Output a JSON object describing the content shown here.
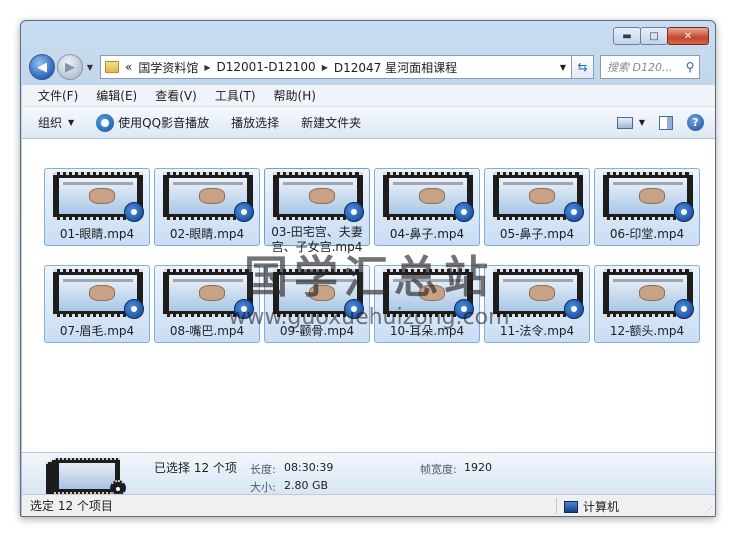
{
  "window": {
    "caption_buttons": {
      "minimize": "▬",
      "maximize": "□",
      "close": "✕"
    }
  },
  "nav": {
    "back_glyph": "◀",
    "forward_glyph": "▶",
    "history_glyph": "▼",
    "breadcrumb_prefix": "«",
    "breadcrumbs": [
      "国学资料馆",
      "D12001-D12100",
      "D12047 星河面相课程"
    ],
    "separator_glyph": "▶",
    "address_dropdown_glyph": "▼",
    "refresh_glyph": "⇆",
    "search_placeholder": "搜索 D120...",
    "search_icon": "search-icon",
    "search_glyph": "⚲"
  },
  "menu": {
    "items": [
      "文件(F)",
      "编辑(E)",
      "查看(V)",
      "工具(T)",
      "帮助(H)"
    ]
  },
  "toolbar": {
    "organize": "组织",
    "caret": "▼",
    "play_qq": "使用QQ影音播放",
    "play_selection": "播放选择",
    "new_folder": "新建文件夹",
    "view_caret": "▼",
    "help_glyph": "?"
  },
  "files": [
    {
      "name": "01-眼睛.mp4"
    },
    {
      "name": "02-眼睛.mp4"
    },
    {
      "name": "03-田宅宫、夫妻宫、子女宫.mp4"
    },
    {
      "name": "04-鼻子.mp4"
    },
    {
      "name": "05-鼻子.mp4"
    },
    {
      "name": "06-印堂.mp4"
    },
    {
      "name": "07-眉毛.mp4"
    },
    {
      "name": "08-嘴巴.mp4"
    },
    {
      "name": "09-颧骨.mp4"
    },
    {
      "name": "10-耳朵.mp4"
    },
    {
      "name": "11-法令.mp4"
    },
    {
      "name": "12-额头.mp4"
    }
  ],
  "watermark": {
    "cn": "国学汇总站",
    "url": "www.guoxuehuizong.com"
  },
  "details": {
    "selected": "已选择 12 个项",
    "length_label": "长度:",
    "length_value": "08:30:39",
    "size_label": "大小:",
    "size_value": "2.80 GB",
    "frame_width_label": "帧宽度:",
    "frame_width_value": "1920"
  },
  "status": {
    "left": "选定 12 个项目",
    "right": "计算机",
    "grip": "⋰"
  }
}
